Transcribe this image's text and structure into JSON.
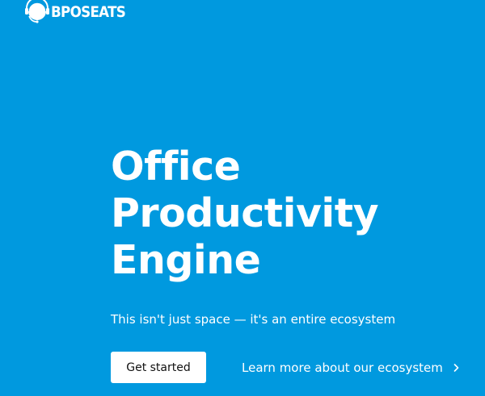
{
  "header": {
    "brand_name": "BPOSEATS",
    "logo_icon": "headset-globe-icon"
  },
  "hero": {
    "title_lines": [
      "Office",
      "Productivity",
      "Engine"
    ],
    "subtitle": "This isn't just space — it's an entire ecosystem",
    "primary_cta_label": "Get started",
    "secondary_cta_label": "Learn more about our ecosystem",
    "secondary_cta_icon": "chevron-right-icon"
  },
  "colors": {
    "background": "#0099df",
    "text": "#ffffff",
    "button_background": "#ffffff",
    "button_text": "#111111"
  }
}
